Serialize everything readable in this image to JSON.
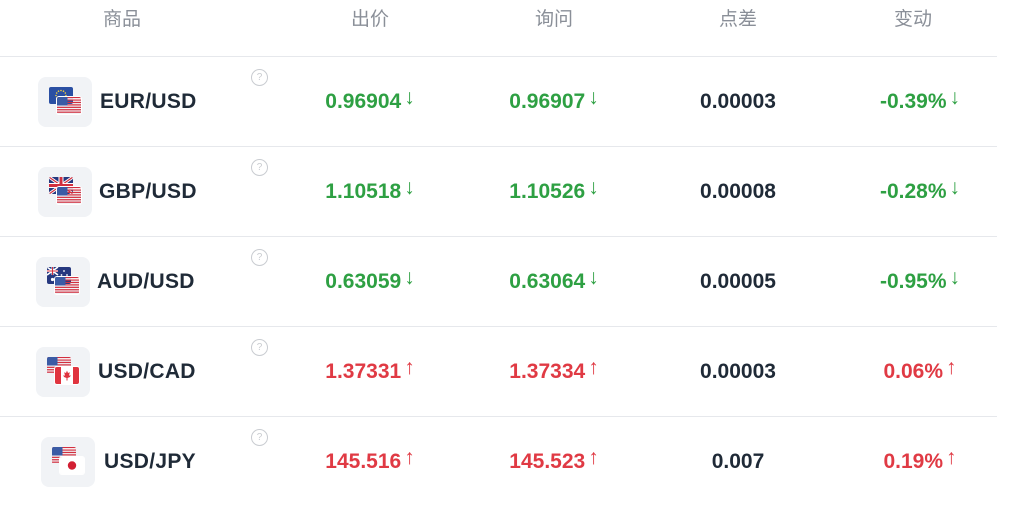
{
  "header": {
    "instrument": "商品",
    "bid": "出价",
    "ask": "询问",
    "spread": "点差",
    "change": "变动"
  },
  "help_glyph": "?",
  "arrow_down": "↓",
  "arrow_up": "↑",
  "colors": {
    "down": "#2ea043",
    "up": "#e03a44",
    "neutral": "#1f2a37"
  },
  "rows": [
    {
      "pair": "EUR/USD",
      "flags": [
        "eu-flag-icon",
        "us-flag-icon"
      ],
      "bid": "0.96904",
      "ask": "0.96907",
      "spread": "0.00003",
      "change": "-0.39%",
      "direction": "down"
    },
    {
      "pair": "GBP/USD",
      "flags": [
        "gb-flag-icon",
        "us-flag-icon"
      ],
      "bid": "1.10518",
      "ask": "1.10526",
      "spread": "0.00008",
      "change": "-0.28%",
      "direction": "down"
    },
    {
      "pair": "AUD/USD",
      "flags": [
        "au-flag-icon",
        "us-flag-icon"
      ],
      "bid": "0.63059",
      "ask": "0.63064",
      "spread": "0.00005",
      "change": "-0.95%",
      "direction": "down"
    },
    {
      "pair": "USD/CAD",
      "flags": [
        "us-flag-icon",
        "ca-flag-icon"
      ],
      "bid": "1.37331",
      "ask": "1.37334",
      "spread": "0.00003",
      "change": "0.06%",
      "direction": "up"
    },
    {
      "pair": "USD/JPY",
      "flags": [
        "us-flag-icon",
        "jp-flag-icon"
      ],
      "bid": "145.516",
      "ask": "145.523",
      "spread": "0.007",
      "change": "0.19%",
      "direction": "up"
    }
  ]
}
